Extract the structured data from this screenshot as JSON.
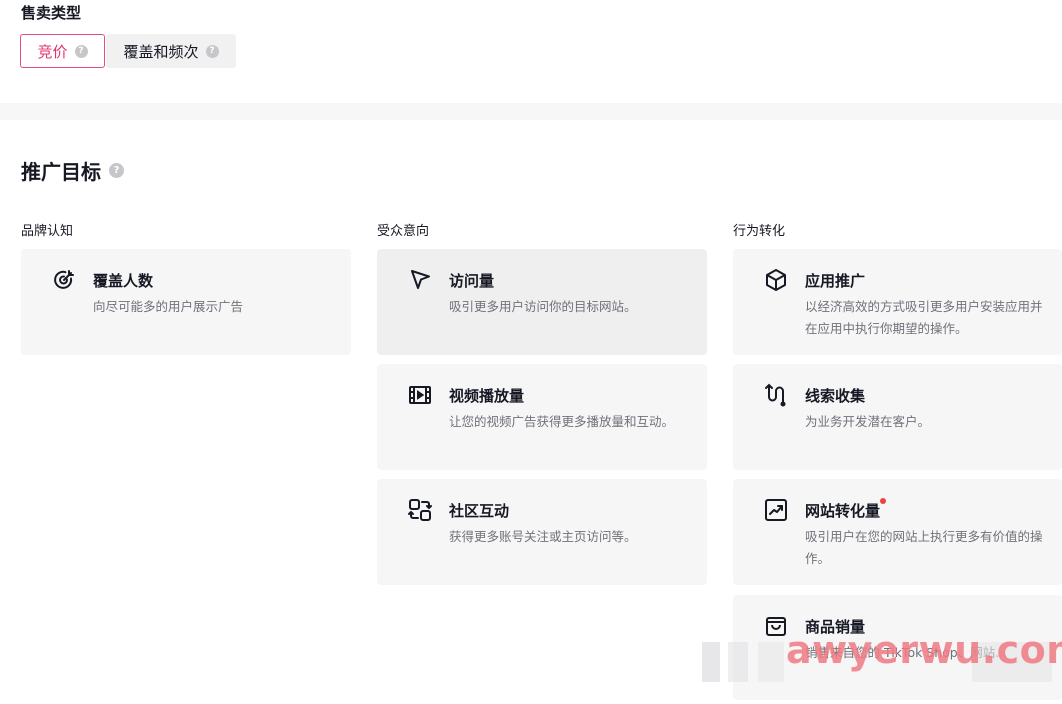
{
  "sale_type": {
    "label": "售卖类型",
    "options": [
      {
        "label": "竞价",
        "selected": true
      },
      {
        "label": "覆盖和频次",
        "selected": false
      }
    ],
    "help_glyph": "?"
  },
  "objective": {
    "title": "推广目标",
    "help_glyph": "?",
    "columns": [
      {
        "header": "品牌认知",
        "cards": [
          {
            "icon": "target-icon",
            "title": "覆盖人数",
            "desc": "向尽可能多的用户展示广告"
          }
        ]
      },
      {
        "header": "受众意向",
        "cards": [
          {
            "icon": "cursor-icon",
            "title": "访问量",
            "desc": "吸引更多用户访问你的目标网站。"
          },
          {
            "icon": "video-icon",
            "title": "视频播放量",
            "desc": "让您的视频广告获得更多播放量和互动。"
          },
          {
            "icon": "community-icon",
            "title": "社区互动",
            "desc": "获得更多账号关注或主页访问等。"
          }
        ]
      },
      {
        "header": "行为转化",
        "cards": [
          {
            "icon": "cube-icon",
            "title": "应用推广",
            "desc": "以经济高效的方式吸引更多用户安装应用并在应用中执行你期望的操作。"
          },
          {
            "icon": "funnel-icon",
            "title": "线索收集",
            "desc": "为业务开发潜在客户。"
          },
          {
            "icon": "trend-icon",
            "title": "网站转化量",
            "desc": "吸引用户在您的网站上执行更多有价值的操作。",
            "new_dot": true
          },
          {
            "icon": "bag-icon",
            "title": "商品销量",
            "desc": "销售来自您的 TikTok Shop、网站..."
          }
        ]
      }
    ]
  },
  "watermark": "awyerwu.com",
  "colors": {
    "accent": "#e0336b",
    "card_bg": "#f6f6f7",
    "dot": "#e8463d"
  }
}
